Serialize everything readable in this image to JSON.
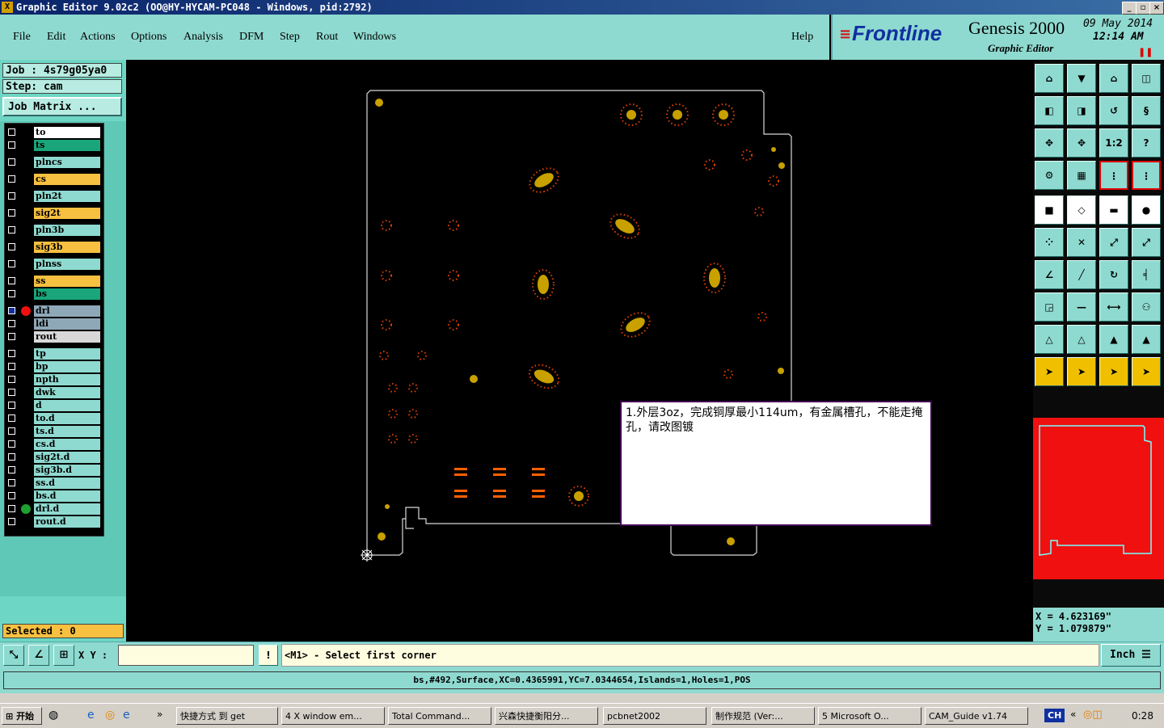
{
  "window": {
    "title": "Graphic Editor 9.02c2 (OO@HY-HYCAM-PC048 - Windows, pid:2792)"
  },
  "menu": {
    "items": [
      "File",
      "Edit",
      "Actions",
      "Options",
      "Analysis",
      "DFM",
      "Step",
      "Rout",
      "Windows"
    ],
    "help": "Help"
  },
  "brand": {
    "logo": "Frontline",
    "product": "Genesis 2000",
    "subtitle": "Graphic Editor",
    "date": "09 May 2014",
    "time": "12:14 AM"
  },
  "job": {
    "job_label": "Job : 4s79g05ya0",
    "step_label": "Step: cam",
    "matrix_button": "Job Matrix ..."
  },
  "layers": [
    {
      "name": "to",
      "color": "#ffffff"
    },
    {
      "name": "ts",
      "color": "#1aa57a"
    },
    {
      "name": "plncs",
      "color": "#8fdad0"
    },
    {
      "name": "cs",
      "color": "#f8c040"
    },
    {
      "name": "pln2t",
      "color": "#8fdad0"
    },
    {
      "name": "sig2t",
      "color": "#f8c040"
    },
    {
      "name": "pln3b",
      "color": "#8fdad0"
    },
    {
      "name": "sig3b",
      "color": "#f8c040"
    },
    {
      "name": "plnss",
      "color": "#8fdad0"
    },
    {
      "name": "ss",
      "color": "#f8c040"
    },
    {
      "name": "bs",
      "color": "#1aa57a"
    },
    {
      "name": "drl",
      "color": "#8fa8b8"
    },
    {
      "name": "ldi",
      "color": "#8fa8b8"
    },
    {
      "name": "rout",
      "color": "#d8d8d8"
    },
    {
      "name": "tp",
      "color": "#8fdad0"
    },
    {
      "name": "bp",
      "color": "#8fdad0"
    },
    {
      "name": "npth",
      "color": "#8fdad0"
    },
    {
      "name": "dwk",
      "color": "#8fdad0"
    },
    {
      "name": "d",
      "color": "#8fdad0"
    },
    {
      "name": "to.d",
      "color": "#8fdad0"
    },
    {
      "name": "ts.d",
      "color": "#8fdad0"
    },
    {
      "name": "cs.d",
      "color": "#8fdad0"
    },
    {
      "name": "sig2t.d",
      "color": "#8fdad0"
    },
    {
      "name": "sig3b.d",
      "color": "#8fdad0"
    },
    {
      "name": "ss.d",
      "color": "#8fdad0"
    },
    {
      "name": "bs.d",
      "color": "#8fdad0"
    },
    {
      "name": "drl.d",
      "color": "#8fdad0"
    },
    {
      "name": "rout.d",
      "color": "#8fdad0"
    }
  ],
  "selected": "Selected : 0",
  "note": {
    "text": "1.外层3oz，完成铜厚最小114um，有金属槽孔，不能走掩孔，请改图镀"
  },
  "coords": {
    "x": "X = 4.623169\"",
    "y": "Y = 1.079879\""
  },
  "command": {
    "xy_label": "X Y :",
    "input_value": "",
    "prompt": "<M1> - Select first corner",
    "units": "Inch"
  },
  "status": {
    "text": "bs,#492,Surface,XC=0.4365991,YC=7.0344654,Islands=1,Holes=1,POS"
  },
  "toolbar": {
    "one_to_two": "1:2",
    "question": "?"
  },
  "taskbar": {
    "start": "开始",
    "items": [
      "快捷方式 到 get",
      "4 X window em...",
      "Total Command...",
      "兴森快捷衡阳分...",
      "pcbnet2002",
      "制作规范 (Ver:...",
      "5 Microsoft O...",
      "CAM_Guide v1.74"
    ],
    "lang": "CH",
    "clock": "0:28"
  }
}
